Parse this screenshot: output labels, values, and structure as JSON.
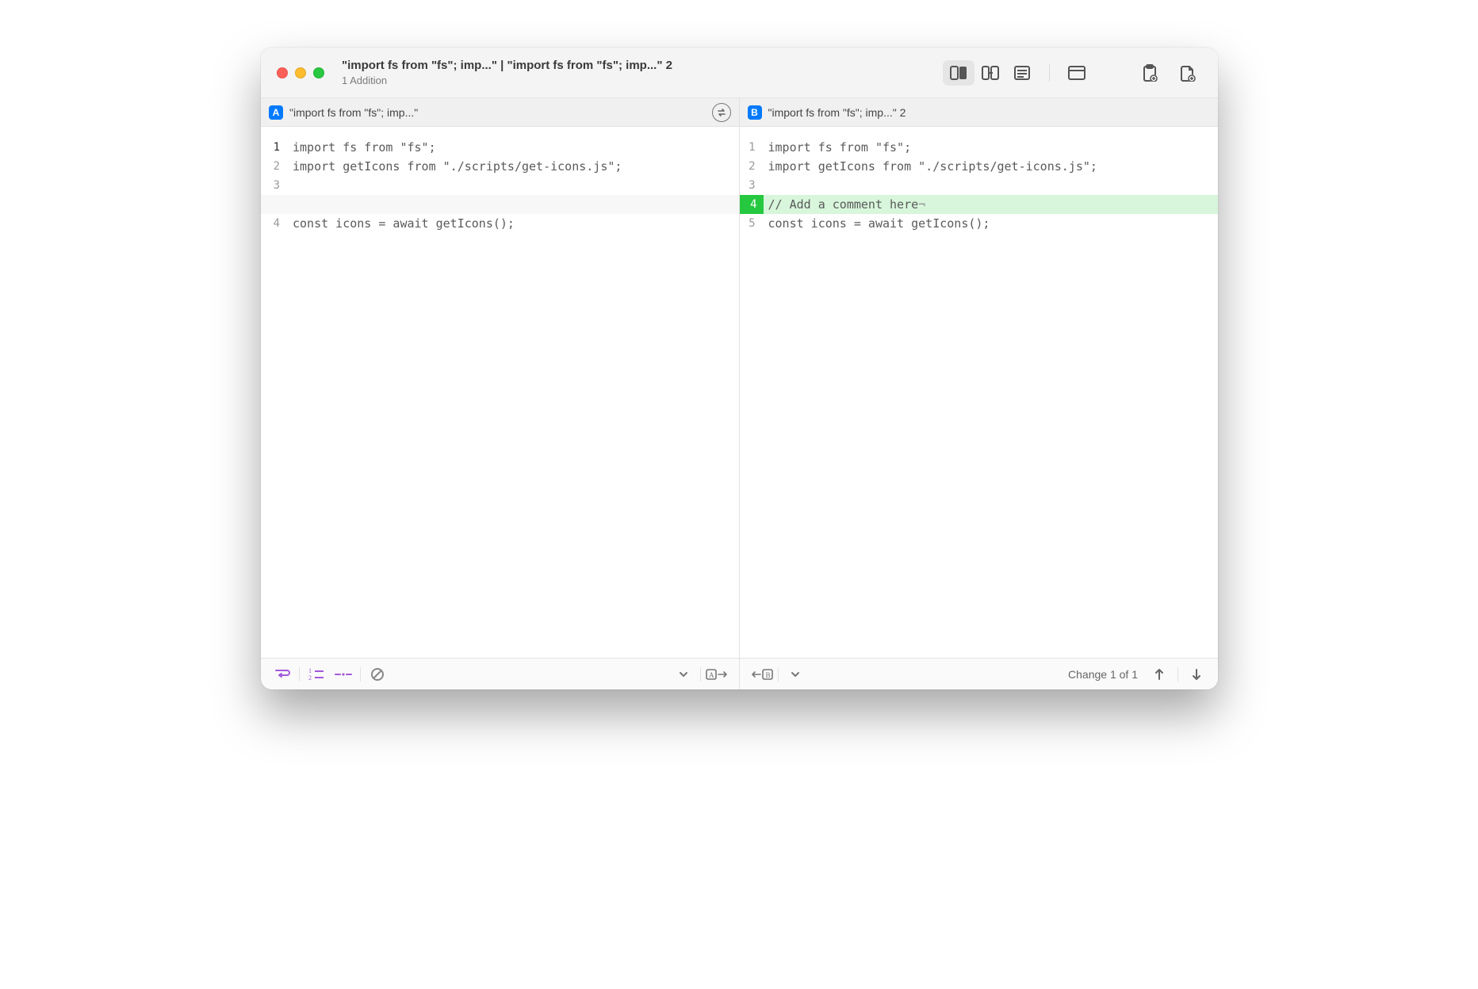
{
  "window": {
    "title": "\"import fs from \"fs\"; imp...\" | \"import fs from \"fs\"; imp...\" 2",
    "subtitle": "1 Addition"
  },
  "tabs": {
    "a_badge": "A",
    "a_label": "\"import fs from \"fs\"; imp...\"",
    "b_badge": "B",
    "b_label": "\"import fs from \"fs\"; imp...\" 2"
  },
  "leftPane": {
    "lines": [
      {
        "n": "1",
        "text": "import fs from \"fs\";",
        "current": true
      },
      {
        "n": "2",
        "text": "import getIcons from \"./scripts/get-icons.js\";"
      },
      {
        "n": "3",
        "text": ""
      },
      {
        "n": "",
        "text": "",
        "spacer": true
      },
      {
        "n": "4",
        "text": "const icons = await getIcons();"
      }
    ]
  },
  "rightPane": {
    "lines": [
      {
        "n": "1",
        "text": "import fs from \"fs\";"
      },
      {
        "n": "2",
        "text": "import getIcons from \"./scripts/get-icons.js\";"
      },
      {
        "n": "3",
        "text": ""
      },
      {
        "n": "4",
        "text": "// Add a comment here",
        "added": true,
        "eol": "¬"
      },
      {
        "n": "5",
        "text": "const icons = await getIcons();"
      }
    ]
  },
  "bottom": {
    "change_status": "Change 1 of 1"
  }
}
